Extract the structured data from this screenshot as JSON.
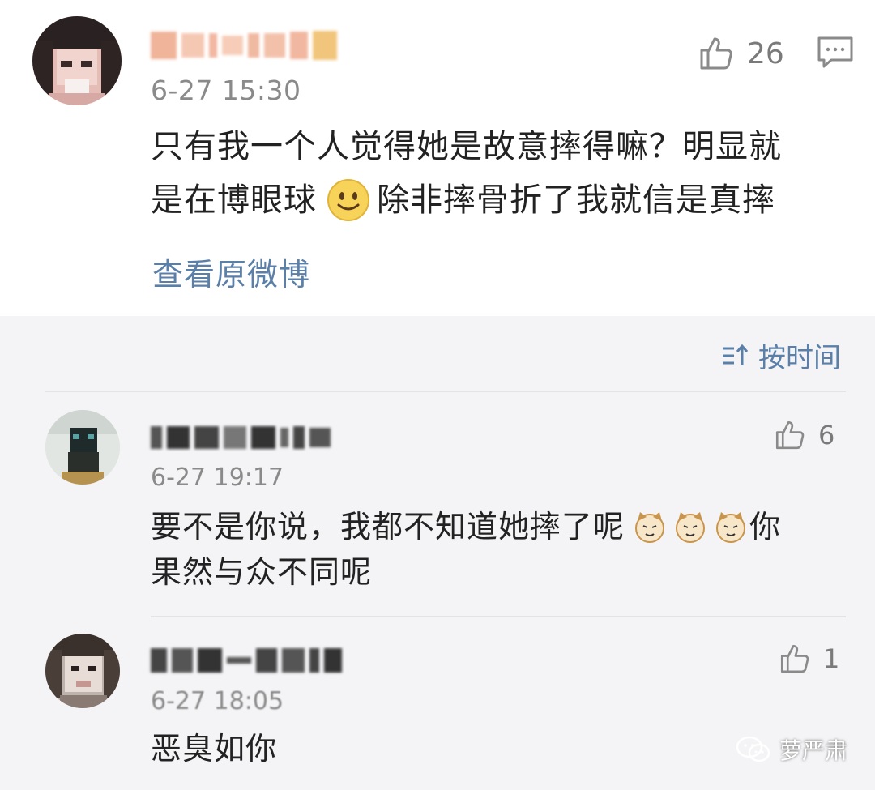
{
  "original_post": {
    "username": "",
    "timestamp": "6-27 15:30",
    "likes": "26",
    "text_line1": "只有我一个人觉得她是故意摔得嘛？明显就",
    "text_line2_a": "是在博眼球",
    "text_line2_b": "除非摔骨折了我就信是真摔",
    "view_original": "查看原微博"
  },
  "sort": {
    "label": "按时间"
  },
  "comments": [
    {
      "timestamp": "6-27 19:17",
      "likes": "6",
      "line1": "要不是你说，我都不知道她摔了呢",
      "line1_tail": "你",
      "line2": "果然与众不同呢"
    },
    {
      "timestamp": "6-27 18:05",
      "likes": "1",
      "line1": "恶臭如你"
    }
  ],
  "watermark": {
    "text": "萝严肃"
  },
  "icons": [
    "thumbs-up-icon",
    "reply-icon",
    "sort-icon",
    "smile-emoji",
    "cat-emoji",
    "wechat-icon"
  ]
}
